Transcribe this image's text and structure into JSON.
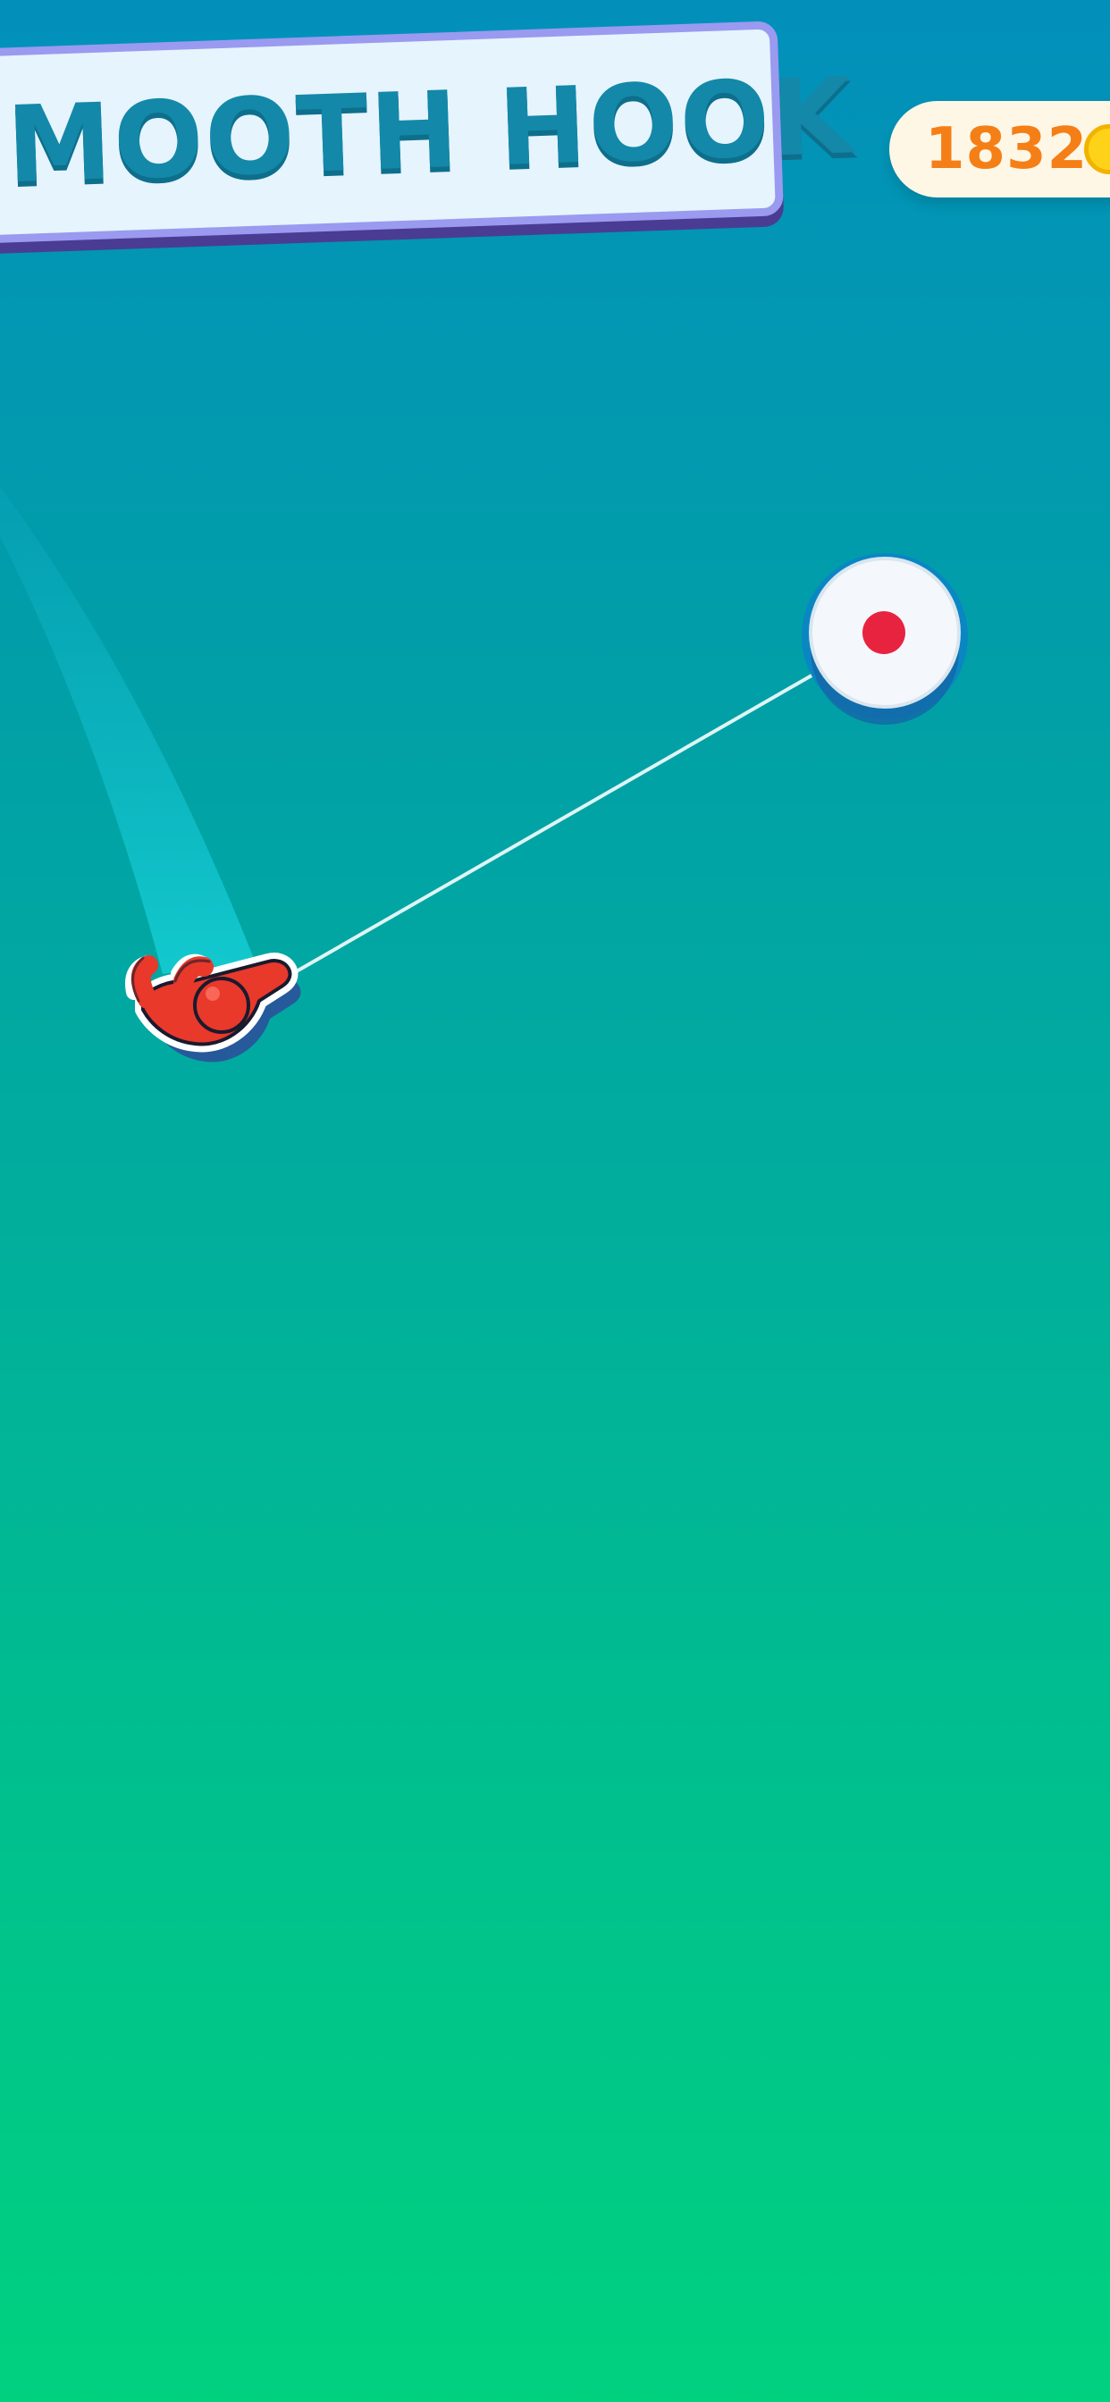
{
  "level": {
    "title": "SMOOTH HOOK"
  },
  "hud": {
    "coins": "1832",
    "coin_icon": "coin-icon"
  },
  "colors": {
    "background_top": "#0290bb",
    "background_bottom": "#00d17f",
    "banner_fill": "#e6f4fd",
    "banner_border": "#9a9af0",
    "title_text": "#1488a8",
    "coin_text": "#f57f17",
    "player": "#e8392b",
    "anchor_dot": "#e8233f"
  },
  "icons": {
    "player": "stickman-player-icon",
    "anchor": "hook-anchor-icon"
  }
}
